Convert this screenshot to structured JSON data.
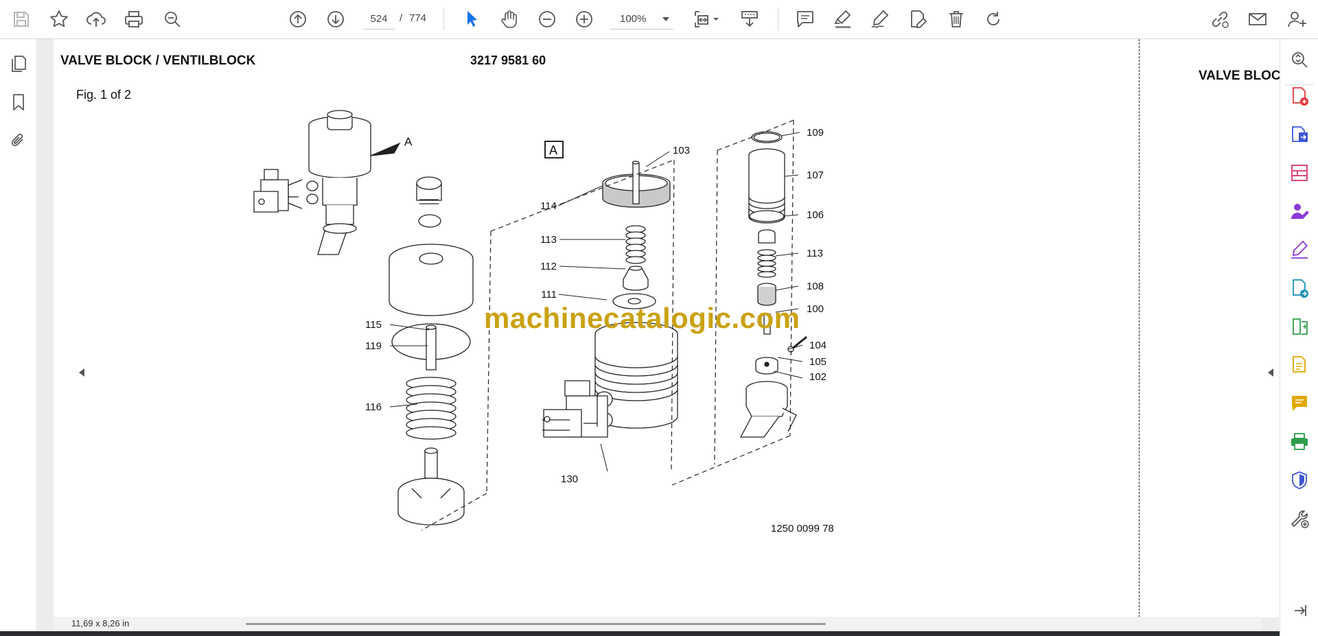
{
  "toolbar": {
    "page_current": "524",
    "page_separator": "/",
    "page_total": "774",
    "zoom": "100%",
    "buttons": [
      "save-icon",
      "bookmark-star-icon",
      "upload-cloud-icon",
      "print-icon",
      "zoom-search-icon",
      "page-up-icon",
      "page-down-icon",
      "select-cursor-icon",
      "hand-tool-icon",
      "zoom-out-icon",
      "zoom-in-icon",
      "fit-page-icon",
      "scroll-mode-icon",
      "comment-icon",
      "highlight-icon",
      "sign-icon",
      "edit-pdf-icon",
      "delete-icon",
      "rotate-icon",
      "share-link-icon",
      "email-icon",
      "account-icon"
    ],
    "accent_color": "#1473e6"
  },
  "document": {
    "title": "VALVE BLOCK / VENTILBLOCK",
    "part_number": "3217 9581 60",
    "figure_label": "Fig. 1 of 2",
    "next_page_title": "VALVE BLOC",
    "drawing_number": "1250 0099 78",
    "detail_marker": "A",
    "detail_pointer": "A",
    "callouts": [
      "103",
      "109",
      "107",
      "106",
      "113",
      "108",
      "100",
      "104",
      "105",
      "102",
      "114",
      "113",
      "112",
      "111",
      "115",
      "119",
      "116",
      "130"
    ],
    "watermark": "machinecatalogic.com"
  },
  "status": {
    "page_size": "11,69 x 8,26 in"
  },
  "left_rail": [
    "pages-thumbnail-icon",
    "bookmarks-icon",
    "attachments-icon"
  ],
  "right_rail": [
    "zoom-fit-icon",
    "create-pdf-icon",
    "export-pdf-icon",
    "organize-pages-icon",
    "request-signature-icon",
    "fill-sign-icon",
    "send-for-review-icon",
    "compress-icon",
    "scan-ocr-icon",
    "comment-tool-icon",
    "print-production-icon",
    "protect-icon",
    "more-tools-icon",
    "expand-panel-icon"
  ]
}
